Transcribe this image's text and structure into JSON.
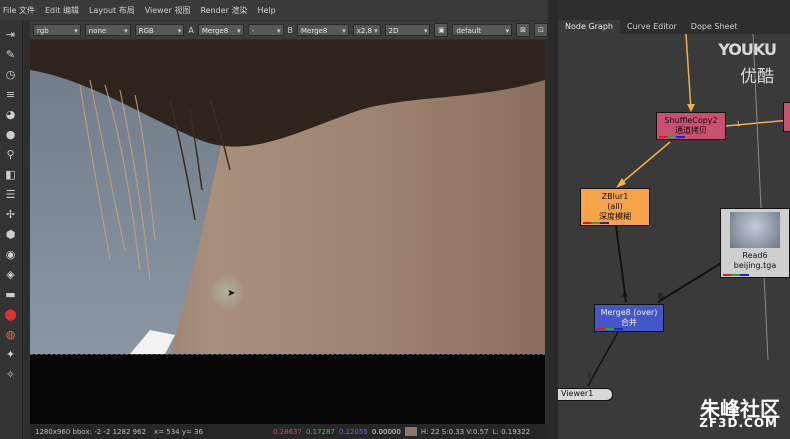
{
  "menu": [
    "File 文件",
    "Edit 编辑",
    "Layout 布局",
    "Viewer 视图",
    "Render 渲染",
    "Help"
  ],
  "viewer_toolbar": {
    "channels": "rgb",
    "alpha": "none",
    "colorspace": "RGB",
    "a_label": "A",
    "input_a": "Merge8",
    "a_op": "-",
    "b_label": "B",
    "input_b": "Merge8",
    "zoom": "x2.8",
    "view_mode": "2D",
    "lut": "default"
  },
  "status": {
    "format": "1280x960 bbox: -2 -2 1282 962",
    "coords": "x= 534 y=  36",
    "r": "0.28637",
    "g": "0.17287",
    "b": "0.12055",
    "a": "0.00000",
    "hsv": "H: 22 S:0.33 V:0.57",
    "luma": "L: 0.19322"
  },
  "tabs": [
    "Node Graph",
    "Curve Editor",
    "Dope Sheet"
  ],
  "nodes": {
    "shuffle": {
      "name": "ShuffleCopy2",
      "sub": "通道拷贝"
    },
    "zblur": {
      "name": "ZBlur1",
      "mode": "(all)",
      "sub": "深度模糊"
    },
    "read": {
      "name": "Read6",
      "file": "beijing.tga"
    },
    "merge": {
      "name": "Merge8 (over)",
      "sub": "合并"
    },
    "viewer": {
      "name": "Viewer1"
    }
  },
  "edge_labels": {
    "a": "A",
    "b": "B",
    "one": "1",
    "one2": "1"
  },
  "watermarks": {
    "youku": "YOUKU",
    "youku_cn": "优酷",
    "zf3d_cn": "朱峰社区",
    "zf3d": "ZF3D.COM"
  },
  "colors": {
    "shuffle": "#c9506e",
    "zblur": "#f7a34c",
    "merge": "#4457c8",
    "pipe": "#f0b04a",
    "swatch": "#8e7566"
  }
}
